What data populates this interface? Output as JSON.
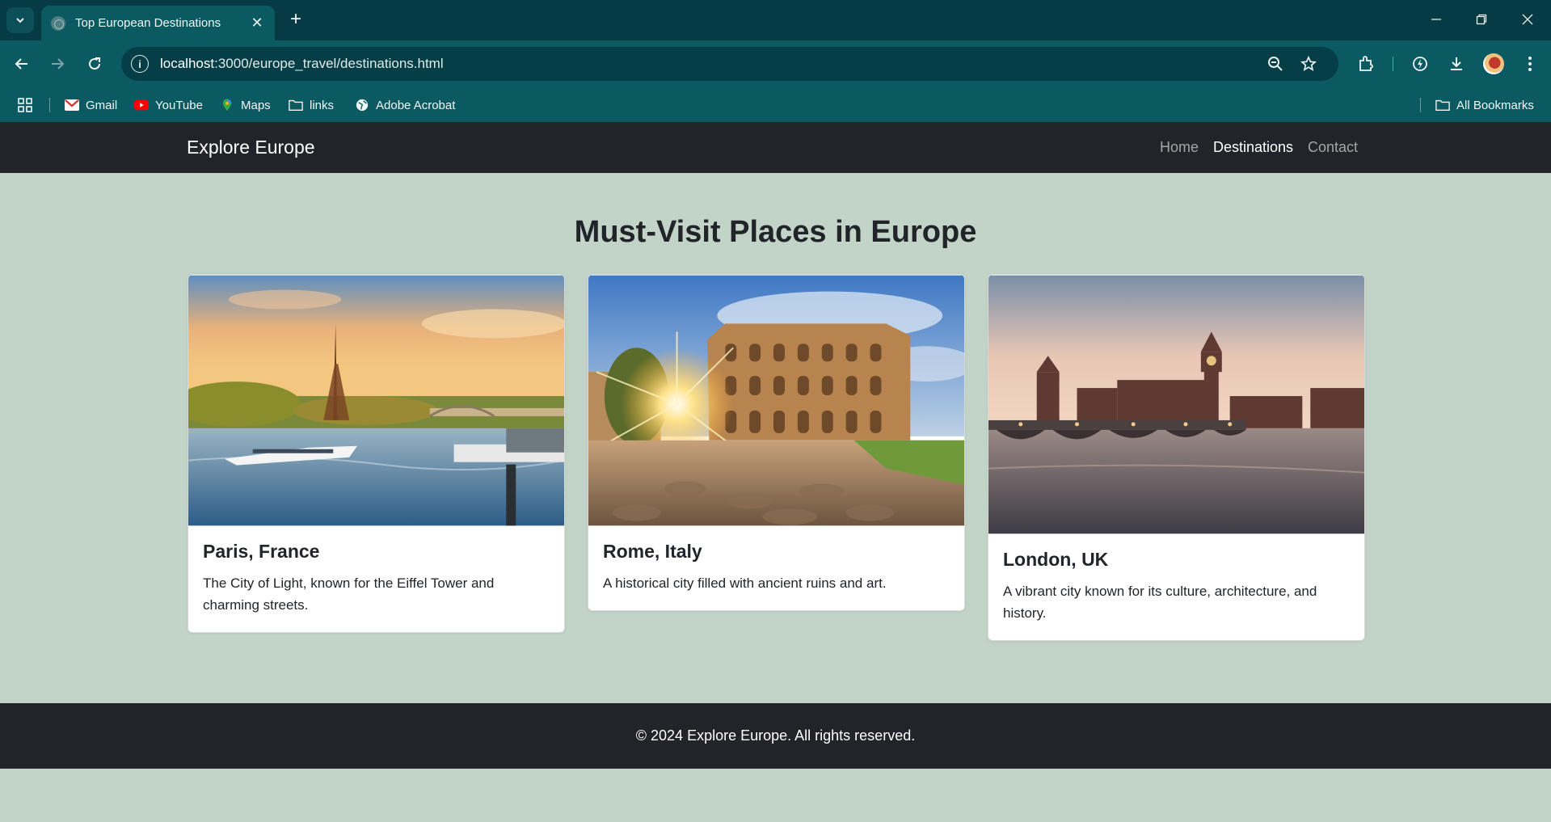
{
  "browser": {
    "tab": {
      "title": "Top European Destinations",
      "close_glyph": "✕"
    },
    "new_tab_glyph": "+",
    "address": {
      "host": "localhost",
      "path": ":3000/europe_travel/destinations.html"
    },
    "bookmarks": [
      {
        "label": "Gmail",
        "icon": "gmail-icon"
      },
      {
        "label": "YouTube",
        "icon": "youtube-icon"
      },
      {
        "label": "Maps",
        "icon": "maps-icon"
      },
      {
        "label": "links",
        "icon": "folder-icon"
      },
      {
        "label": "Adobe Acrobat",
        "icon": "globe-icon"
      }
    ],
    "all_bookmarks": "All Bookmarks"
  },
  "site": {
    "brand": "Explore Europe",
    "nav": [
      {
        "label": "Home",
        "active": false
      },
      {
        "label": "Destinations",
        "active": true
      },
      {
        "label": "Contact",
        "active": false
      }
    ],
    "heading": "Must-Visit Places in Europe",
    "cards": [
      {
        "title": "Paris, France",
        "text": "The City of Light, known for the Eiffel Tower and charming streets.",
        "image": "paris-eiffel-tower-seine-photo"
      },
      {
        "title": "Rome, Italy",
        "text": "A historical city filled with ancient ruins and art.",
        "image": "rome-colosseum-sunburst-photo"
      },
      {
        "title": "London, UK",
        "text": "A vibrant city known for its culture, architecture, and history.",
        "image": "london-westminster-bridge-big-ben-photo"
      }
    ],
    "footer": "© 2024 Explore Europe. All rights reserved."
  },
  "colors": {
    "chrome_dark": "#063b44",
    "chrome": "#0b5a61",
    "navbar": "#212529",
    "page_bg": "#c2d3c7"
  }
}
